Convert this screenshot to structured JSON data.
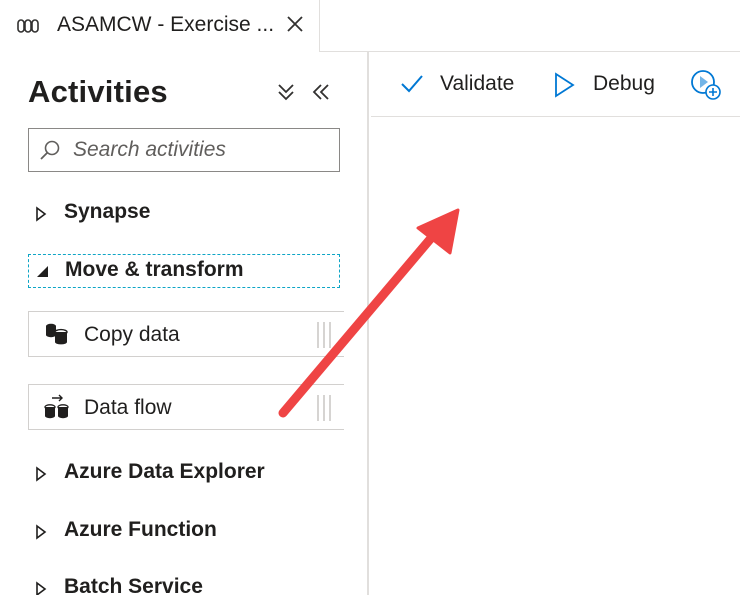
{
  "tab": {
    "title": "ASAMCW - Exercise ...",
    "icon": "pipeline-icon",
    "close_icon": "close-icon"
  },
  "activities": {
    "title": "Activities",
    "collapse_all_icon": "double-chevron-down-icon",
    "collapse_pane_icon": "double-chevron-left-icon",
    "search_placeholder": "Search activities",
    "categories": [
      {
        "label": "Synapse",
        "expanded": false
      },
      {
        "label": "Move & transform",
        "expanded": true,
        "focused": true,
        "items": [
          {
            "label": "Copy data",
            "icon": "copy-data-icon"
          },
          {
            "label": "Data flow",
            "icon": "data-flow-icon"
          }
        ]
      },
      {
        "label": "Azure Data Explorer",
        "expanded": false
      },
      {
        "label": "Azure Function",
        "expanded": false
      },
      {
        "label": "Batch Service",
        "expanded": false
      }
    ]
  },
  "toolbar": {
    "validate_label": "Validate",
    "validate_icon": "checkmark-icon",
    "debug_label": "Debug",
    "debug_icon": "play-icon",
    "trigger_icon": "add-trigger-icon"
  },
  "colors": {
    "accent": "#0078d4",
    "focus_outline": "#0ea5c6",
    "annotation_arrow": "#ef4444"
  }
}
